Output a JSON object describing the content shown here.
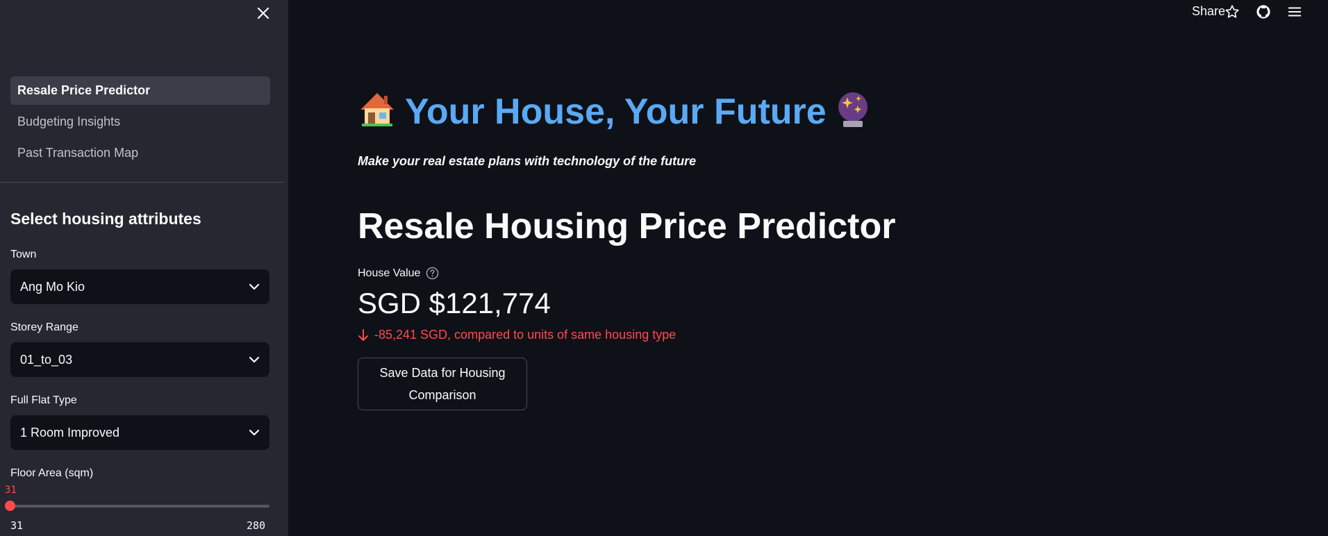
{
  "sidebar": {
    "nav": [
      {
        "label": "Resale Price Predictor",
        "active": true
      },
      {
        "label": "Budgeting Insights",
        "active": false
      },
      {
        "label": "Past Transaction Map",
        "active": false
      }
    ],
    "header": "Select housing attributes",
    "fields": {
      "town": {
        "label": "Town",
        "value": "Ang Mo Kio"
      },
      "storey": {
        "label": "Storey Range",
        "value": "01_to_03"
      },
      "flat_type": {
        "label": "Full Flat Type",
        "value": "1 Room Improved"
      },
      "floor_area": {
        "label": "Floor Area (sqm)",
        "value": "31",
        "min": "31",
        "max": "280",
        "fraction": 0.0
      }
    }
  },
  "toolbar": {
    "share_label": "Share",
    "icons": [
      "star-icon",
      "github-icon",
      "menu-icon"
    ]
  },
  "main": {
    "hero_title": "Your House, Your Future",
    "hero_left_icon": "house-icon",
    "hero_right_icon": "crystal-ball-icon",
    "subtitle": "Make your real estate plans with technology of the future",
    "page_title": "Resale Housing Price Predictor",
    "metric": {
      "label": "House Value",
      "value": "SGD $121,774",
      "delta": "-85,241 SGD, compared to units of same housing type"
    },
    "save_button": "Save Data for Housing Comparison"
  },
  "colors": {
    "background": "#0e1117",
    "sidebar": "#262730",
    "accent_blue": "#5aa9f4",
    "negative_red": "#ff4b4b"
  }
}
